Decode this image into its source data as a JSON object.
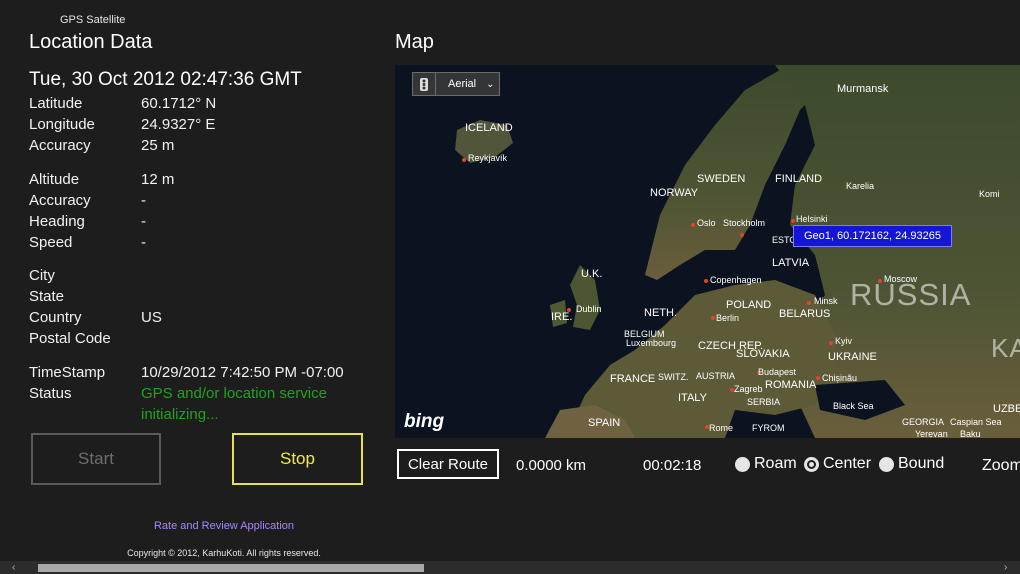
{
  "app": {
    "title": "GPS Satellite"
  },
  "location": {
    "heading": "Location Data",
    "datetime": "Tue, 30 Oct 2012 02:47:36 GMT",
    "rows_a": [
      {
        "label": "Latitude",
        "value": "60.1712° N"
      },
      {
        "label": "Longitude",
        "value": "24.9327° E"
      },
      {
        "label": "Accuracy",
        "value": "25 m"
      }
    ],
    "rows_b": [
      {
        "label": "Altitude",
        "value": "12 m"
      },
      {
        "label": "Accuracy",
        "value": "-"
      },
      {
        "label": "Heading",
        "value": "-"
      },
      {
        "label": "Speed",
        "value": "-"
      }
    ],
    "rows_c": [
      {
        "label": "City",
        "value": ""
      },
      {
        "label": "State",
        "value": ""
      },
      {
        "label": "Country",
        "value": "US"
      },
      {
        "label": "Postal Code",
        "value": ""
      }
    ],
    "timestamp_label": "TimeStamp",
    "timestamp_value": "10/29/2012 7:42:50 PM -07:00",
    "status_label": "Status",
    "status_line1": "GPS and/or location service",
    "status_line2": "initializing...",
    "status_color": "#1fa31f"
  },
  "buttons": {
    "start": "Start",
    "stop": "Stop",
    "stop_color": "#f1ea4f"
  },
  "footer": {
    "rate_link": "Rate and Review Application",
    "copyright": "Copyright © 2012, KarhuKoti. All rights reserved."
  },
  "map": {
    "heading": "Map",
    "view_mode": "Aerial",
    "pin_label": "Geo1, 60.172162, 24.93265",
    "bing_logo": "bing",
    "labels": {
      "murmansk": "Murmansk",
      "iceland": "ICELAND",
      "reykjavik": "Reykjavík",
      "norway": "NORWAY",
      "sweden": "SWEDEN",
      "finland": "FINLAND",
      "karelia": "Karelia",
      "komi": "Komi",
      "helsinki": "Helsinki",
      "oslo": "Oslo",
      "stockholm": "Stockholm",
      "estonia": "ESTO",
      "uk": "U.K.",
      "latvia": "LATVIA",
      "copenhagen": "Copenhagen",
      "moscow": "Moscow",
      "dublin": "Dublin",
      "ire": "IRE.",
      "neth": "NETH.",
      "poland": "POLAND",
      "russia": "RUSSIA",
      "berlin": "Berlin",
      "minsk": "Minsk",
      "belarus": "BELARUS",
      "belgium": "BELGIUM",
      "luxembourg": "Luxembourg",
      "czech": "CZECH REP.",
      "kyiv": "Kyiv",
      "slovakia": "SLOVAKIA",
      "ukraine": "UKRAINE",
      "france": "FRANCE",
      "switz": "SWITZ.",
      "austria": "AUSTRIA",
      "budapest": "Budapest",
      "chisinau": "Chișinău",
      "zagreb": "Zagreb",
      "romania": "ROMANIA",
      "italy": "ITALY",
      "serbia": "SERBIA",
      "blacksea": "Black Sea",
      "spain": "SPAIN",
      "rome": "Rome",
      "fyrom": "FYROM",
      "georgia": "GEORGIA",
      "yerevan": "Yerevan",
      "baku": "Baku",
      "caspian": "Caspian Sea",
      "uzbe": "UZBE",
      "ka": "KA"
    }
  },
  "route": {
    "clear_label": "Clear Route",
    "distance": "0.0000 km",
    "elapsed": "00:02:18",
    "modes": [
      "Roam",
      "Center",
      "Bound"
    ],
    "selected_mode": "Center",
    "zoom_label": "Zoom"
  },
  "scrollbar": {
    "left_arrow": "‹",
    "right_arrow": "›"
  }
}
